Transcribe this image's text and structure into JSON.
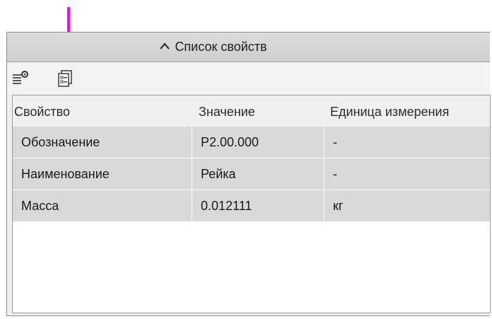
{
  "panel": {
    "title": "Список свойств",
    "collapse_icon": "chevron-up-icon"
  },
  "toolbar": {
    "buttons": [
      {
        "icon": "property-settings-icon"
      },
      {
        "icon": "property-list-icon"
      }
    ]
  },
  "annotation": {
    "color": "#ff00ff",
    "icon": "down-arrow-indicator"
  },
  "table": {
    "headers": [
      "Свойство",
      "Значение",
      "Единица измерения"
    ],
    "rows": [
      [
        "Обозначение",
        "Р2.00.000",
        "-"
      ],
      [
        "Наименование",
        "Рейка",
        "-"
      ],
      [
        "Масса",
        "0.012111",
        "кг"
      ]
    ]
  }
}
